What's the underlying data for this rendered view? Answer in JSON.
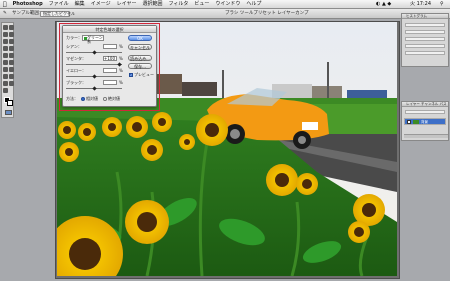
{
  "app": {
    "name": "Photoshop"
  },
  "menu": {
    "items": [
      "ファイル",
      "編集",
      "イメージ",
      "レイヤー",
      "選択範囲",
      "フィルタ",
      "ビュー",
      "ウインドウ",
      "ヘルプ"
    ],
    "clock": "火 17:24"
  },
  "optionsbar": {
    "tool_label": "サンプル範囲：",
    "sample_value": "指定したピクセル",
    "workspace_label": "ブラシ ツールプリセット レイヤーカンプ"
  },
  "dialog": {
    "title": "特定色域の選択",
    "color_label": "カラー：",
    "color_value": "グリーン系",
    "sliders": [
      {
        "label": "シアン：",
        "value": "",
        "percent": "%",
        "position": 0.5
      },
      {
        "label": "マゼンタ：",
        "value": "+100",
        "percent": "%",
        "position": 0.95
      },
      {
        "label": "イエロー：",
        "value": "",
        "percent": "%",
        "position": 0.5
      },
      {
        "label": "ブラック：",
        "value": "",
        "percent": "%",
        "position": 0.5
      }
    ],
    "method_label": "方法：",
    "method_options": [
      "相対値",
      "絶対値"
    ],
    "method_selected": "相対値",
    "buttons": {
      "ok": "OK",
      "cancel": "キャンセル",
      "load": "読み込み...",
      "save": "保存..."
    },
    "preview_label": "プレビュー",
    "preview_checked": true
  },
  "panels": {
    "top_title": "ヒストグラム",
    "layers_title": "レイヤー チャンネル パス",
    "layer_name": "背景"
  }
}
